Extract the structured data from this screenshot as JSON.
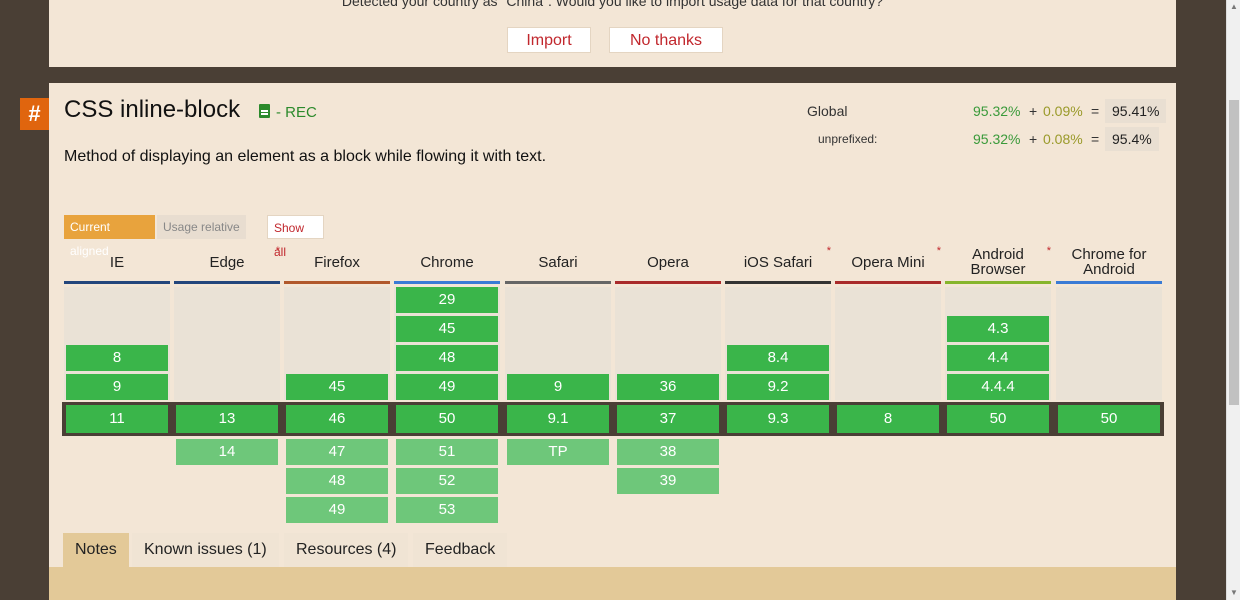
{
  "banner": {
    "message": "Detected your country as \"China\". Would you like to import usage data for that country?",
    "import_label": "Import",
    "no_thanks_label": "No thanks"
  },
  "feature": {
    "hash": "#",
    "title": "CSS inline-block",
    "status": "- REC",
    "description": "Method of displaying an element as a block while flowing it with text."
  },
  "usage": {
    "global_label": "Global",
    "unprefixed_label": "unprefixed:",
    "global": {
      "supported": "95.32%",
      "plus": "+",
      "partial": "0.09%",
      "equals": "=",
      "total": "95.41%"
    },
    "unprefixed": {
      "supported": "95.32%",
      "plus": "+",
      "partial": "0.08%",
      "equals": "=",
      "total": "95.4%"
    }
  },
  "toggles": {
    "current_aligned": "Current aligned",
    "usage_relative": "Usage relative",
    "show_all": "Show all"
  },
  "browsers": [
    {
      "name": "IE",
      "star": false,
      "color": "#23467c"
    },
    {
      "name": "Edge",
      "star": true,
      "color": "#23467c"
    },
    {
      "name": "Firefox",
      "star": false,
      "color": "#b1582b"
    },
    {
      "name": "Chrome",
      "star": false,
      "color": "#3a7bd5"
    },
    {
      "name": "Safari",
      "star": false,
      "color": "#666666"
    },
    {
      "name": "Opera",
      "star": false,
      "color": "#a92a2a"
    },
    {
      "name": "iOS Safari",
      "star": true,
      "color": "#333333"
    },
    {
      "name": "Opera Mini",
      "star": true,
      "color": "#a92a2a"
    },
    {
      "name": "Android Browser",
      "star": true,
      "color": "#86b52c"
    },
    {
      "name": "Chrome for Android",
      "star": false,
      "color": "#3a7bd5"
    }
  ],
  "versions": {
    "ie": {
      "past": [
        "8",
        "9"
      ],
      "current": "11",
      "future": []
    },
    "edge": {
      "past": [],
      "current": "13",
      "future": [
        "14"
      ]
    },
    "firefox": {
      "past": [
        "45"
      ],
      "current": "46",
      "future": [
        "47",
        "48",
        "49"
      ]
    },
    "chrome": {
      "past": [
        "29",
        "45",
        "48",
        "49"
      ],
      "current": "50",
      "future": [
        "51",
        "52",
        "53"
      ]
    },
    "safari": {
      "past": [
        "9"
      ],
      "current": "9.1",
      "future": [
        "TP"
      ]
    },
    "opera": {
      "past": [
        "36"
      ],
      "current": "37",
      "future": [
        "38",
        "39"
      ]
    },
    "ios_safari": {
      "past": [
        "8.4",
        "9.2"
      ],
      "current": "9.3",
      "future": []
    },
    "opera_mini": {
      "past": [],
      "current": "8",
      "future": []
    },
    "android_browser": {
      "past": [
        "4.3",
        "4.4",
        "4.4.4"
      ],
      "current": "50",
      "future": []
    },
    "chrome_android": {
      "past": [],
      "current": "50",
      "future": []
    }
  },
  "tabs": [
    {
      "label": "Notes",
      "active": true
    },
    {
      "label": "Known issues (1)",
      "active": false
    },
    {
      "label": "Resources (4)",
      "active": false
    },
    {
      "label": "Feedback",
      "active": false
    }
  ],
  "colors": {
    "supported_past": "#3ab54a",
    "supported_future": "#6ec77a",
    "accent": "#e0650e",
    "link_red": "#c1272d"
  }
}
